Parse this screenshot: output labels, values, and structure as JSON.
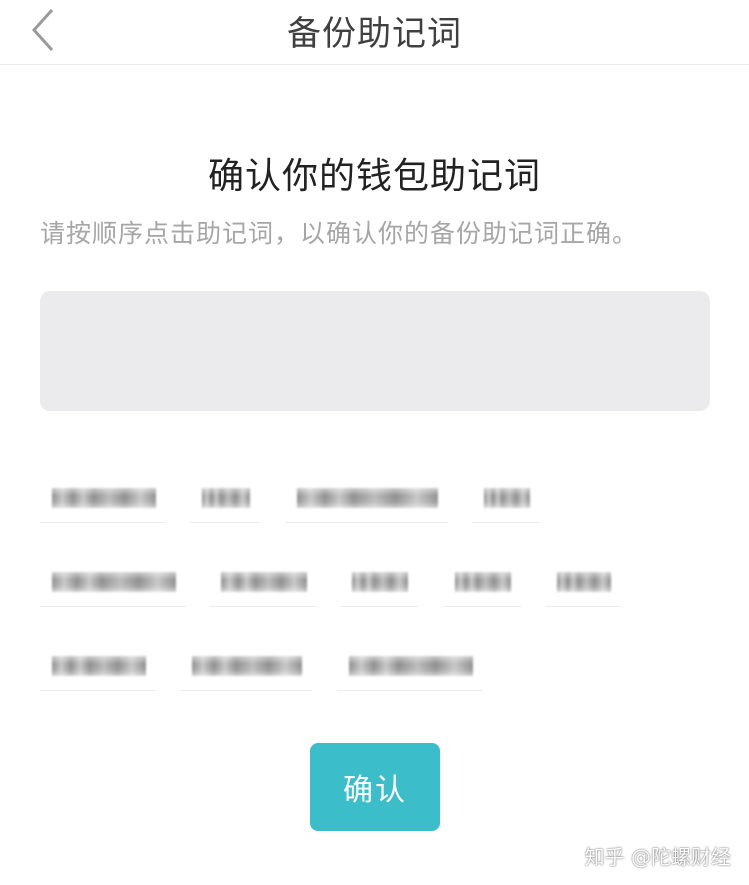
{
  "navbar": {
    "title": "备份助记词",
    "back_icon": "chevron-left-icon"
  },
  "main": {
    "heading": "确认你的钱包助记词",
    "description": "请按顺序点击助记词，以确认你的备份助记词正确。",
    "confirm_label": "确认"
  },
  "word_chips": [
    {
      "state": "blurred"
    },
    {
      "state": "blurred"
    },
    {
      "state": "blurred"
    },
    {
      "state": "blurred"
    },
    {
      "state": "blurred"
    },
    {
      "state": "blurred"
    },
    {
      "state": "blurred"
    },
    {
      "state": "blurred"
    },
    {
      "state": "blurred"
    },
    {
      "state": "blurred"
    },
    {
      "state": "blurred"
    },
    {
      "state": "blurred"
    }
  ],
  "watermark": "知乎 @陀螺财经",
  "colors": {
    "accent": "#3bbdca",
    "box": "#ebebed",
    "muted_text": "#a6a6a6"
  }
}
